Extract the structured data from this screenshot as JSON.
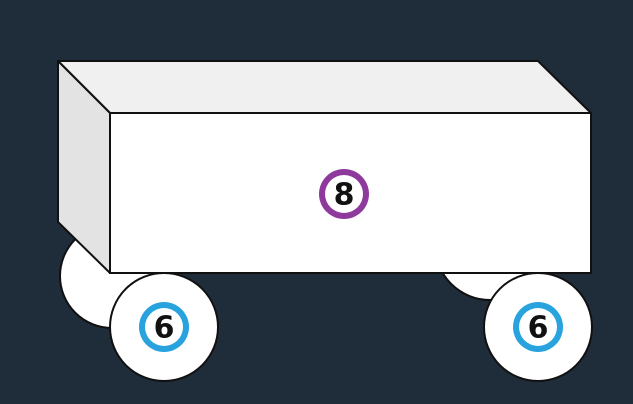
{
  "colors": {
    "background": "#1f2d3a",
    "outline": "#111111",
    "box_front": "#ffffff",
    "box_top": "#f0f0f0",
    "box_side": "#e3e3e3",
    "wheel": "#ffffff",
    "body_badge_ring": "#8e3a9d",
    "wheel_badge_ring": "#29a3de"
  },
  "body": {
    "badge_label": "8"
  },
  "wheels": {
    "front_left_label": "6",
    "front_right_label": "6"
  }
}
